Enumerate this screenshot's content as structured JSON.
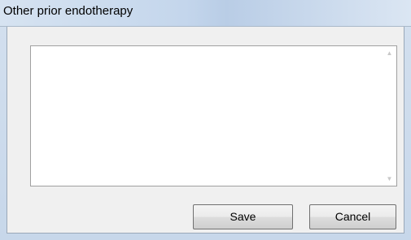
{
  "window": {
    "title": "Other prior endotherapy"
  },
  "text_input": {
    "value": ""
  },
  "scrollbar": {
    "up_icon": "scroll-up-arrow",
    "down_icon": "scroll-down-arrow"
  },
  "buttons": {
    "save_label": "Save",
    "cancel_label": "Cancel"
  }
}
